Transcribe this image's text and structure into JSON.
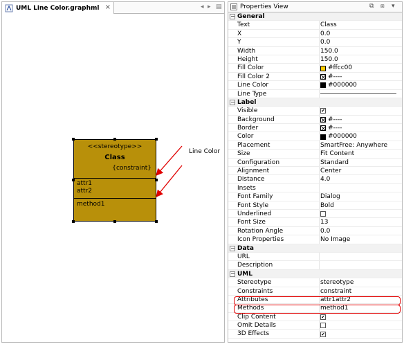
{
  "editor": {
    "tab_title": "UML Line Color.graphml",
    "close_glyph": "×",
    "controls": [
      "◂",
      "▸",
      "▤"
    ]
  },
  "uml_node": {
    "stereotype": "<<stereotype>>",
    "name": "Class",
    "constraint": "{constraint}",
    "attributes": [
      "attr1",
      "attr2"
    ],
    "methods": [
      "method1"
    ],
    "fill_color": "#b8900a"
  },
  "annotation": {
    "label": "Line Color",
    "arrow_color": "#e00000"
  },
  "properties": {
    "title": "Properties View",
    "controls": [
      "⧉",
      "⧈",
      "▾"
    ],
    "groups": [
      {
        "name": "General",
        "toggle": "−",
        "rows": [
          {
            "key": "Text",
            "value": "Class"
          },
          {
            "key": "X",
            "value": "0.0"
          },
          {
            "key": "Y",
            "value": "0.0"
          },
          {
            "key": "Width",
            "value": "150.0"
          },
          {
            "key": "Height",
            "value": "150.0"
          },
          {
            "key": "Fill Color",
            "value": "#ffcc00",
            "swatch": "#ffcc00"
          },
          {
            "key": "Fill Color 2",
            "value": "#----",
            "swatch": "none"
          },
          {
            "key": "Line Color",
            "value": "#000000",
            "swatch": "#000000"
          },
          {
            "key": "Line Type",
            "value": "",
            "linetype": true
          }
        ]
      },
      {
        "name": "Label",
        "toggle": "−",
        "rows": [
          {
            "key": "Visible",
            "value": "",
            "check": true
          },
          {
            "key": "Background",
            "value": "#----",
            "swatch": "none"
          },
          {
            "key": "Border",
            "value": "#----",
            "swatch": "none"
          },
          {
            "key": "Color",
            "value": "#000000",
            "swatch": "#000000"
          },
          {
            "key": "Placement",
            "value": "SmartFree: Anywhere"
          },
          {
            "key": "Size",
            "value": "Fit Content"
          },
          {
            "key": "Configuration",
            "value": "Standard"
          },
          {
            "key": "Alignment",
            "value": "Center"
          },
          {
            "key": "Distance",
            "value": "4.0"
          },
          {
            "key": "Insets",
            "value": ""
          },
          {
            "key": "Font Family",
            "value": "Dialog"
          },
          {
            "key": "Font Style",
            "value": "Bold"
          },
          {
            "key": "Underlined",
            "value": "",
            "check": false
          },
          {
            "key": "Font Size",
            "value": "13"
          },
          {
            "key": "Rotation Angle",
            "value": "0.0"
          },
          {
            "key": "Icon Properties",
            "value": "No Image"
          }
        ]
      },
      {
        "name": "Data",
        "toggle": "−",
        "rows": [
          {
            "key": "URL",
            "value": ""
          },
          {
            "key": "Description",
            "value": ""
          }
        ]
      },
      {
        "name": "UML",
        "toggle": "−",
        "rows": [
          {
            "key": "Stereotype",
            "value": "stereotype"
          },
          {
            "key": "Constraints",
            "value": "constraint"
          },
          {
            "key": "Attributes",
            "value": "attr1attr2",
            "highlight": true
          },
          {
            "key": "Methods",
            "value": "method1",
            "highlight": true
          },
          {
            "key": "Clip Content",
            "value": "",
            "check": true
          },
          {
            "key": "Omit Details",
            "value": "",
            "check": false
          },
          {
            "key": "3D Effects",
            "value": "",
            "check": true
          }
        ]
      }
    ]
  }
}
